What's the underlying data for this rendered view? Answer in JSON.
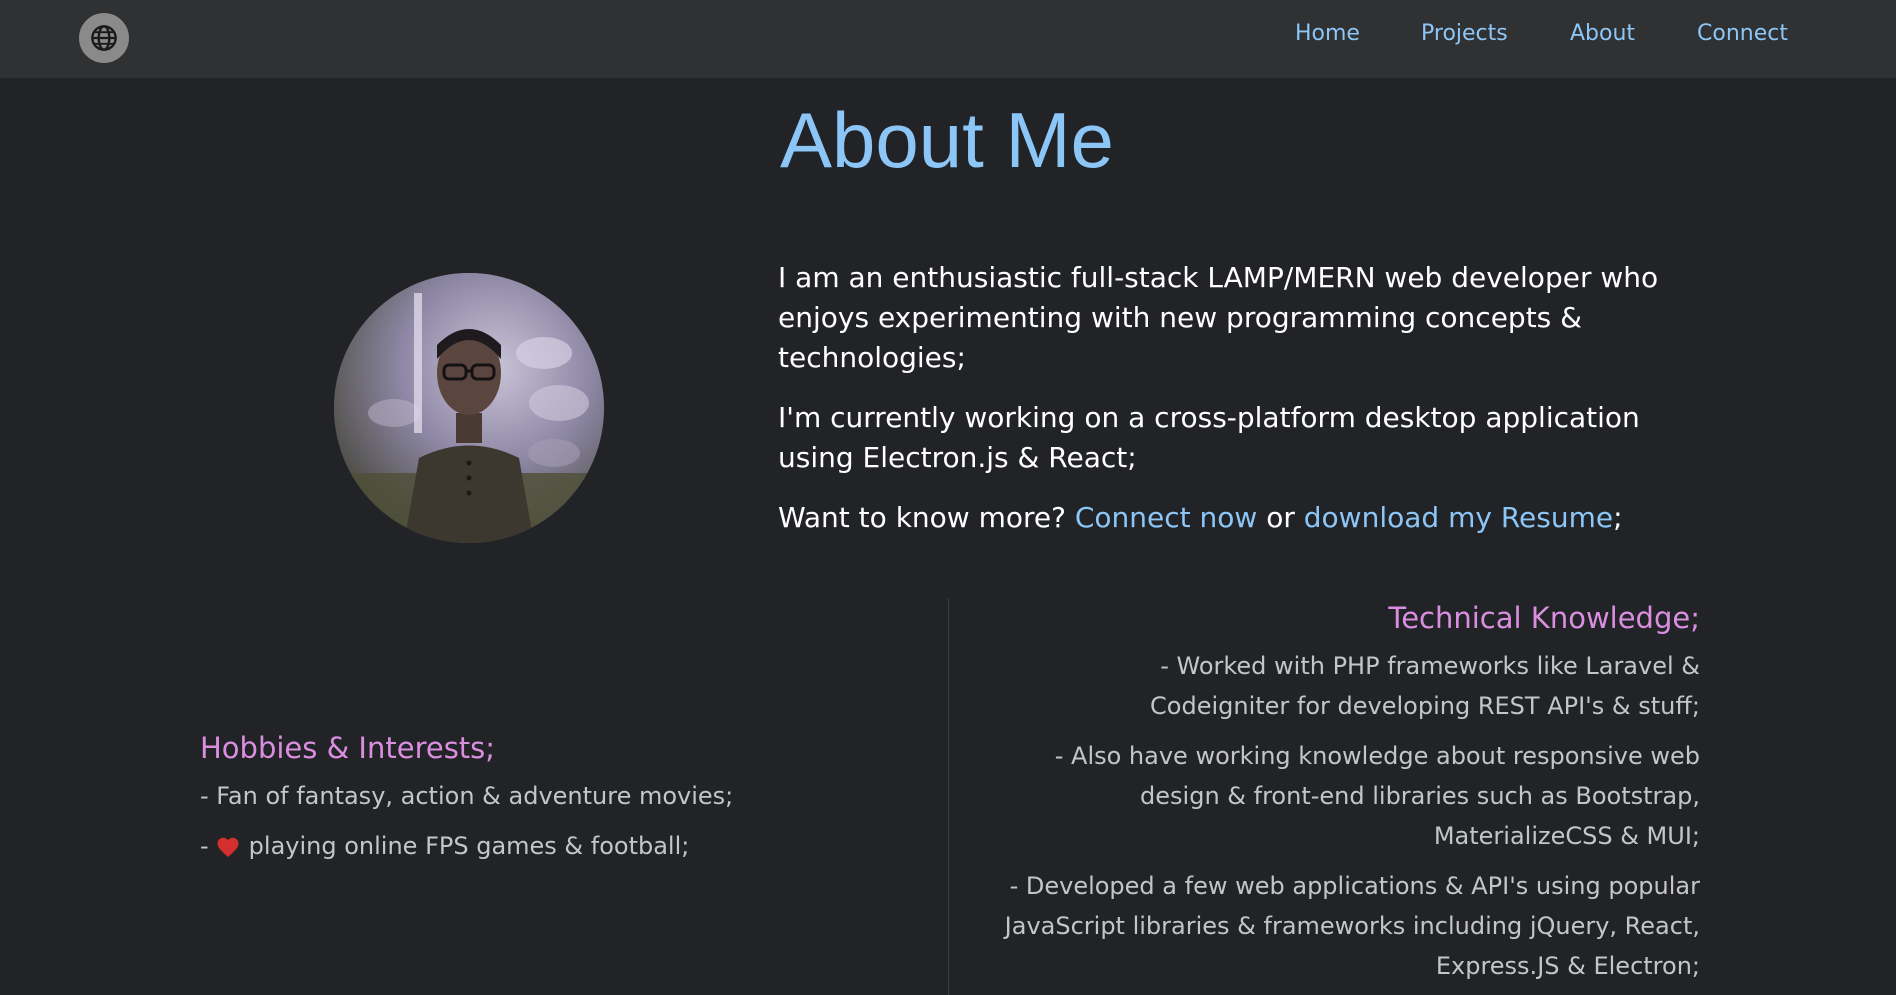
{
  "nav": {
    "items": [
      {
        "label": "Home"
      },
      {
        "label": "Projects"
      },
      {
        "label": "About"
      },
      {
        "label": "Connect"
      }
    ]
  },
  "page": {
    "title": "About Me"
  },
  "intro": {
    "paragraph1": "I am an enthusiastic full-stack LAMP/MERN web developer who enjoys experimenting with new programming concepts & technologies;",
    "paragraph2": "I'm currently working on a cross-platform desktop application using Electron.js & React;",
    "paragraph3_prefix": "Want to know more? ",
    "connect_link": "Connect now",
    "paragraph3_middle": " or ",
    "resume_link": "download my Resume",
    "paragraph3_suffix": ";"
  },
  "hobbies": {
    "heading": "Hobbies & Interests;",
    "item1": "- Fan of fantasy, action & adventure movies;",
    "item2_prefix": "-",
    "item2_text": "playing online FPS games & football;"
  },
  "tech": {
    "heading": "Technical Knowledge;",
    "items": [
      "- Worked with PHP frameworks like Laravel & Codeigniter for developing REST API's & stuff;",
      "- Also have working knowledge about responsive web design & front-end libraries such as Bootstrap, MaterializeCSS & MUI;",
      "- Developed a few web applications & API's using popular JavaScript libraries & frameworks including jQuery, React, Express.JS & Electron;"
    ]
  },
  "icons": {
    "logo": "globe-icon",
    "heart": "heart-icon",
    "avatar": "profile-photo"
  },
  "colors": {
    "accent": "#8cc6f7",
    "heading": "#da8ee0",
    "background": "#222326",
    "navbar": "#303133",
    "heart": "#d32f2f"
  }
}
